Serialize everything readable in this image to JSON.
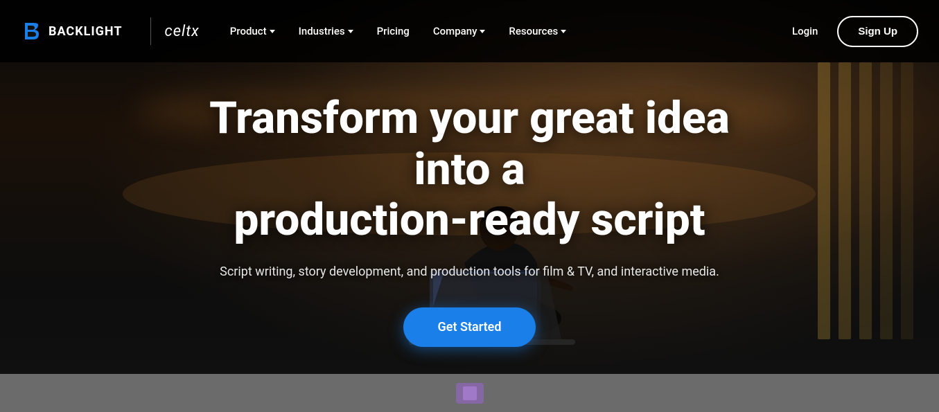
{
  "brand": {
    "backlight_text": "BACKLIGHT",
    "celtx_text": "celtx",
    "backlight_icon_color": "#1a7fe8"
  },
  "navbar": {
    "items": [
      {
        "label": "Product",
        "has_dropdown": true
      },
      {
        "label": "Industries",
        "has_dropdown": true
      },
      {
        "label": "Pricing",
        "has_dropdown": false
      },
      {
        "label": "Company",
        "has_dropdown": true
      },
      {
        "label": "Resources",
        "has_dropdown": true
      }
    ],
    "login_label": "Login",
    "signup_label": "Sign Up"
  },
  "hero": {
    "title_line1": "Transform your great idea into a",
    "title_line2": "production-ready script",
    "subtitle": "Script writing, story development, and production tools for film & TV, and interactive media.",
    "cta_label": "Get Started"
  },
  "colors": {
    "accent_blue": "#1a7fe8",
    "nav_bg": "rgba(0,0,0,0.85)",
    "hero_text": "#ffffff"
  }
}
